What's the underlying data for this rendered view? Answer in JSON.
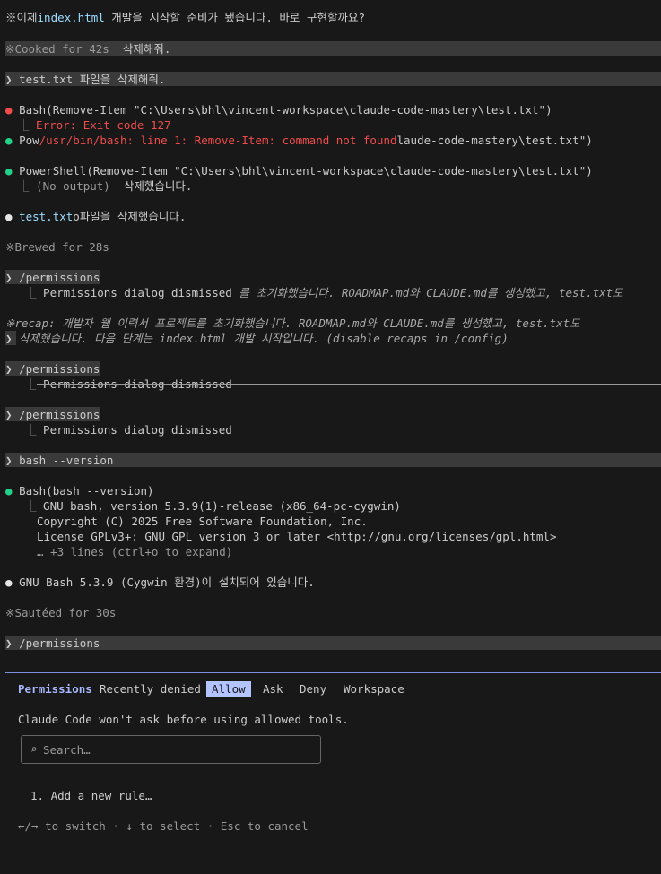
{
  "transcript": {
    "l1_prefix": "※이제",
    "l1_file": "index.html",
    "l1_rest": " 개발을 시작할 준비가 됐습니다. 바로 구현할까요?",
    "cooked": "※Cooked for 42s",
    "cooked_overlay": "삭제해줘.",
    "prompt_mark": "❯",
    "prompt1": "test.txt 파일을 삭제해줘.",
    "bash_tool": "Bash",
    "bash_args": "(Remove-Item \"C:\\Users\\bhl\\vincent-workspace\\claude-code-mastery\\test.txt\")",
    "bash_error": "Error: Exit code 127",
    "pow_prefix": "Pow",
    "pow_error": "/usr/bin/bash: line 1: Remove-Item: command not found",
    "pow_rest": "laude-code-mastery\\test.txt\")",
    "ps_tool": "PowerShell",
    "ps_args": "(Remove-Item \"C:\\Users\\bhl\\vincent-workspace\\claude-code-mastery\\test.txt\")",
    "ps_output": "(No output)",
    "ps_overlay": "삭제했습니다.",
    "deleted_file": "test.txt",
    "deleted_rest": "o파일을 삭제했습니다.",
    "brewed": "※Brewed for 28s",
    "perm_cmd": "/permissions",
    "perm_dismissed": "Permissions dialog dismissed",
    "perm_overlay": "를 초기화했습니다. ROADMAP.md와 CLAUDE.md를 생성했고, test.txt도",
    "recap_label": "※recap:",
    "recap_text1": " 개발자 웹 이력서 프로젝트를 초기화했습니다. ROADMAP.md와 CLAUDE.md를 생성했고, test.txt도",
    "recap_text2": "삭제했습니다. 다음 단계는 index.html 개발 시작입니다. (disable recaps in /config)",
    "bash_version_cmd": "bash --version",
    "bash2_args": "(bash --version)",
    "out1": "GNU bash, version 5.3.9(1)-release (x86_64-pc-cygwin)",
    "out2": "Copyright (C) 2025 Free Software Foundation, Inc.",
    "out3": "License GPLv3+: GNU GPL version 3 or later <http://gnu.org/licenses/gpl.html>",
    "out4": "… +3 lines (ctrl+o to expand)",
    "gnu_summary": "GNU Bash 5.3.9 (Cygwin 환경)이 설치되어 있습니다.",
    "sauteed": "※Sautéed for 30s",
    "tree_mark": "⎿",
    "bullet": "●"
  },
  "panel": {
    "title": "Permissions",
    "tabs": [
      "Recently denied",
      "Allow",
      "Ask",
      "Deny",
      "Workspace"
    ],
    "selected_tab": "Allow",
    "description": "Claude Code won't ask before using allowed tools.",
    "search_icon": "⌕",
    "search_placeholder": "Search…",
    "rule_item": "1. Add a new rule…",
    "help": "←/→ to switch · ↓ to select · Esc to cancel"
  },
  "colors": {
    "background": "#181818",
    "accent": "#b4c4ff",
    "error": "#f14c4c",
    "success": "#23d18b",
    "path_blue": "#9cdcfe"
  }
}
